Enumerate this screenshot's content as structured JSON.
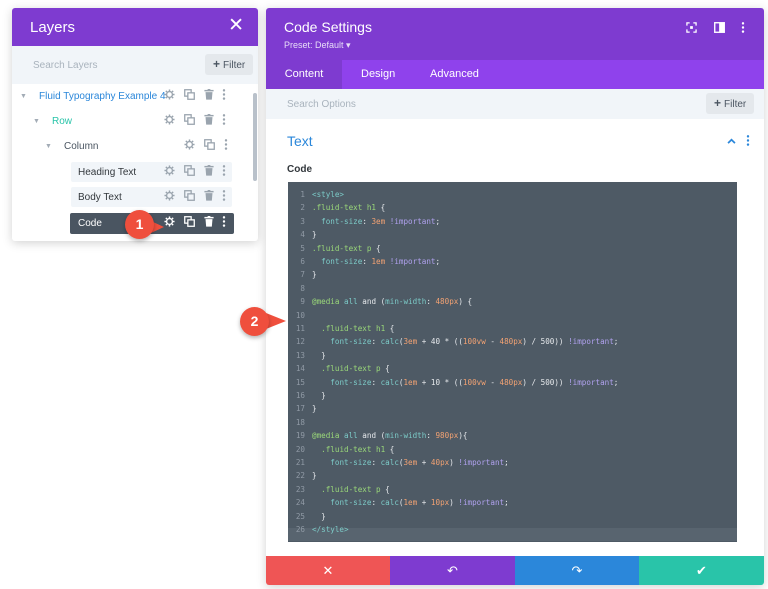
{
  "layers_panel": {
    "title": "Layers",
    "close_icon": "✕",
    "search_placeholder": "Search Layers",
    "filter_label": "Filter",
    "items": [
      {
        "label": "Fluid Typography Example 4",
        "color": "#2b87da"
      },
      {
        "label": "Row",
        "color": "#29c4a9"
      },
      {
        "label": "Column",
        "color": "#4a5561"
      },
      {
        "label": "Heading Text",
        "color": "#32373c"
      },
      {
        "label": "Body Text",
        "color": "#32373c"
      },
      {
        "label": "Code",
        "color": "#ffffff"
      }
    ]
  },
  "settings_panel": {
    "title": "Code Settings",
    "preset": "Preset: Default ▾",
    "tabs": [
      "Content",
      "Design",
      "Advanced"
    ],
    "active_tab": "Content",
    "search_placeholder": "Search Options",
    "filter_label": "Filter",
    "section_title": "Text",
    "code_label": "Code",
    "code_lines": [
      "<style>",
      ".fluid-text h1 {",
      "  font-size: 3em !important;",
      "}",
      ".fluid-text p {",
      "  font-size: 1em !important;",
      "}",
      "",
      "@media all and (min-width: 480px) {",
      "",
      "  .fluid-text h1 {",
      "    font-size: calc(3em + 40 * ((100vw - 480px) / 500)) !important;",
      "  }",
      "  .fluid-text p {",
      "    font-size: calc(1em + 10 * ((100vw - 480px) / 500)) !important;",
      "  }",
      "}",
      "",
      "@media all and (min-width: 980px){",
      "  .fluid-text h1 {",
      "    font-size: calc(3em + 40px) !important;",
      "}",
      "  .fluid-text p {",
      "    font-size: calc(1em + 10px) !important;",
      "  }",
      "</style>"
    ],
    "footer_buttons": [
      {
        "icon": "close-icon",
        "glyph": "✕",
        "color": "#ef5555"
      },
      {
        "icon": "undo-icon",
        "glyph": "↶",
        "color": "#7e3bd0"
      },
      {
        "icon": "redo-icon",
        "glyph": "↷",
        "color": "#2b87da"
      },
      {
        "icon": "check-icon",
        "glyph": "✔",
        "color": "#29c4a9"
      }
    ]
  },
  "badges": [
    "1",
    "2"
  ],
  "colors": {
    "purple_header": "#7e3bd0",
    "purple_tabs": "#8f42ec",
    "code_bg": "#4e5a65",
    "badge": "#ef4f3d"
  }
}
